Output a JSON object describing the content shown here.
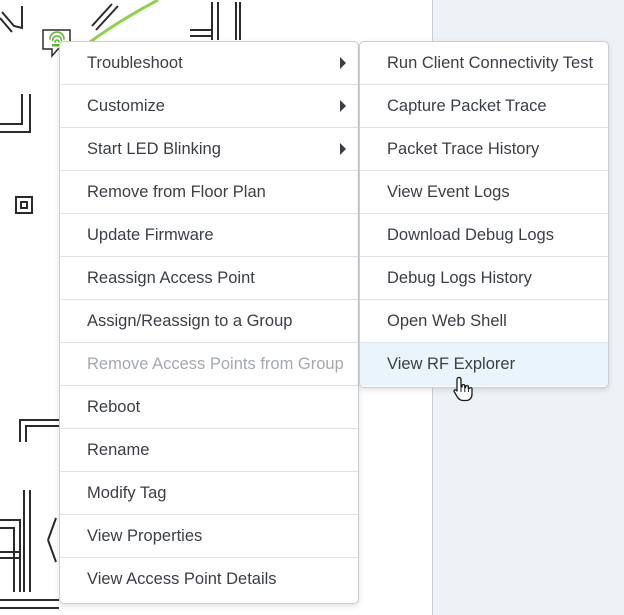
{
  "context_menu": {
    "items": [
      {
        "label": "Troubleshoot",
        "has_submenu": true,
        "enabled": true
      },
      {
        "label": "Customize",
        "has_submenu": true,
        "enabled": true
      },
      {
        "label": "Start LED Blinking",
        "has_submenu": true,
        "enabled": true
      },
      {
        "label": "Remove from Floor Plan",
        "has_submenu": false,
        "enabled": true
      },
      {
        "label": "Update Firmware",
        "has_submenu": false,
        "enabled": true
      },
      {
        "label": "Reassign Access Point",
        "has_submenu": false,
        "enabled": true
      },
      {
        "label": "Assign/Reassign to a Group",
        "has_submenu": false,
        "enabled": true
      },
      {
        "label": "Remove Access Points from Group",
        "has_submenu": false,
        "enabled": false
      },
      {
        "label": "Reboot",
        "has_submenu": false,
        "enabled": true
      },
      {
        "label": "Rename",
        "has_submenu": false,
        "enabled": true
      },
      {
        "label": "Modify Tag",
        "has_submenu": false,
        "enabled": true
      },
      {
        "label": "View Properties",
        "has_submenu": false,
        "enabled": true
      },
      {
        "label": "View Access Point Details",
        "has_submenu": false,
        "enabled": true
      }
    ]
  },
  "troubleshoot_submenu": {
    "items": [
      {
        "label": "Run Client Connectivity Test"
      },
      {
        "label": "Capture Packet Trace"
      },
      {
        "label": "Packet Trace History"
      },
      {
        "label": "View Event Logs"
      },
      {
        "label": "Download Debug Logs"
      },
      {
        "label": "Debug Logs History"
      },
      {
        "label": "Open Web Shell"
      },
      {
        "label": "View RF Explorer",
        "hovered": true
      }
    ]
  },
  "colors": {
    "coverage_arc": "#8fd14f",
    "ap_icon": "#5fb531",
    "hover_background": "#eaf4fd",
    "disabled_text": "#a3a9af"
  },
  "icons": {
    "access_point": "wifi-access-point-icon",
    "submenu_indicator": "triangle-right-icon",
    "pointer": "hand-pointer-icon"
  }
}
